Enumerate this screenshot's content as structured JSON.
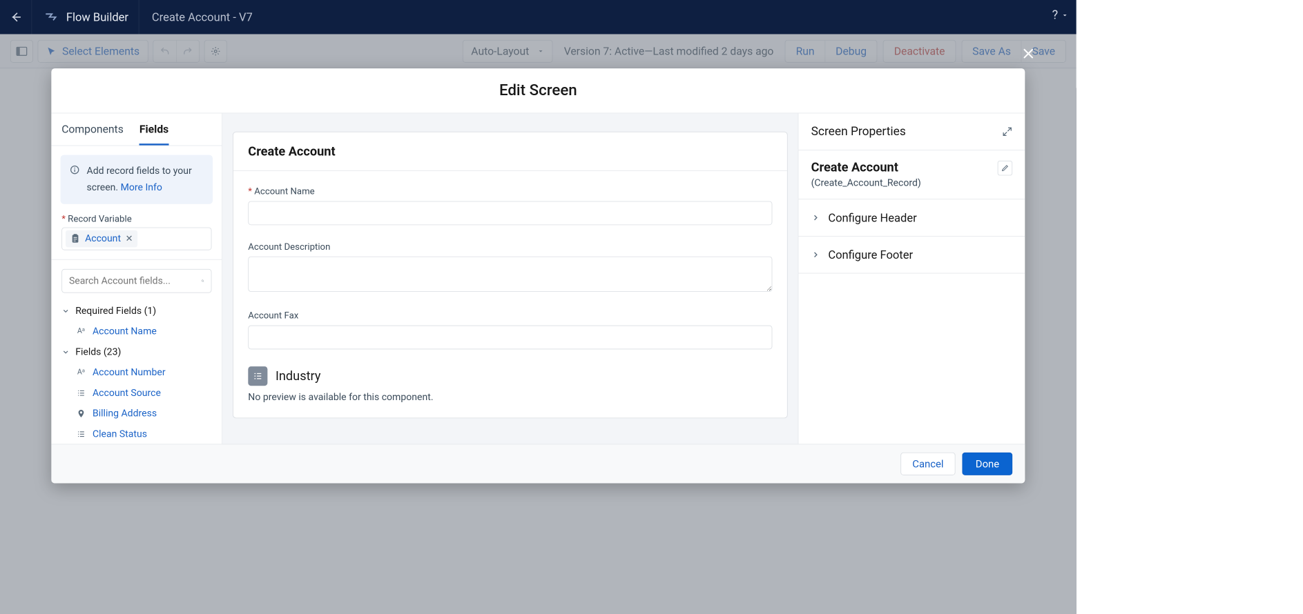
{
  "topbar": {
    "app_name": "Flow Builder",
    "breadcrumb": "Create Account - V7",
    "help": "?"
  },
  "toolbar": {
    "select_elements": "Select Elements",
    "auto_layout": "Auto-Layout",
    "version_text": "Version 7: Active—Last modified 2 days ago",
    "run": "Run",
    "debug": "Debug",
    "deactivate": "Deactivate",
    "save_as": "Save As",
    "save": "Save"
  },
  "modal": {
    "title": "Edit Screen",
    "footer": {
      "cancel": "Cancel",
      "done": "Done"
    }
  },
  "left": {
    "tabs": {
      "components": "Components",
      "fields": "Fields"
    },
    "info_text": "Add record fields to your screen.",
    "info_link": "More Info",
    "record_variable_label": "Record Variable",
    "record_variable_value": "Account",
    "search_placeholder": "Search Account fields...",
    "sections": {
      "required": "Required Fields (1)",
      "fields": "Fields (23)"
    },
    "required_items": [
      "Account Name"
    ],
    "fields_items": [
      "Account Number",
      "Account Source",
      "Billing Address",
      "Clean Status"
    ]
  },
  "canvas": {
    "form_title": "Create Account",
    "account_name_label": "Account Name",
    "account_description_label": "Account Description",
    "account_fax_label": "Account Fax",
    "industry_label": "Industry",
    "no_preview": "No preview is available for this component."
  },
  "right": {
    "title": "Screen Properties",
    "screen_name": "Create Account",
    "api_name": "(Create_Account_Record)",
    "configure_header": "Configure Header",
    "configure_footer": "Configure Footer"
  }
}
